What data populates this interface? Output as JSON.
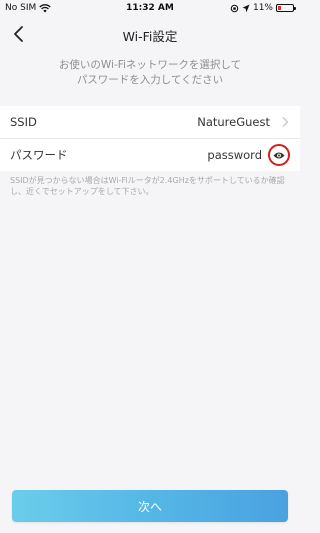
{
  "status_bar": {
    "carrier": "No SIM",
    "time": "11:32 AM",
    "battery": "11%",
    "battery_level": 0.11
  },
  "nav": {
    "title": "Wi-Fi設定"
  },
  "instruction": "お使いのWi-Fiネットワークを選択して\nパスワードを入力してください",
  "form": {
    "ssid_label": "SSID",
    "ssid_value": "NatureGuest",
    "password_label": "パスワード",
    "password_value": "password"
  },
  "hint": "SSIDが見つからない場合はWi-Fiルータが2.4GHzをサポートしているか確認し、近くでセットアップをして下さい。",
  "next_button": "次へ",
  "colors": {
    "accent_start": "#6bcdeb",
    "accent_end": "#4aa1e0",
    "highlight": "#d21f1f"
  }
}
